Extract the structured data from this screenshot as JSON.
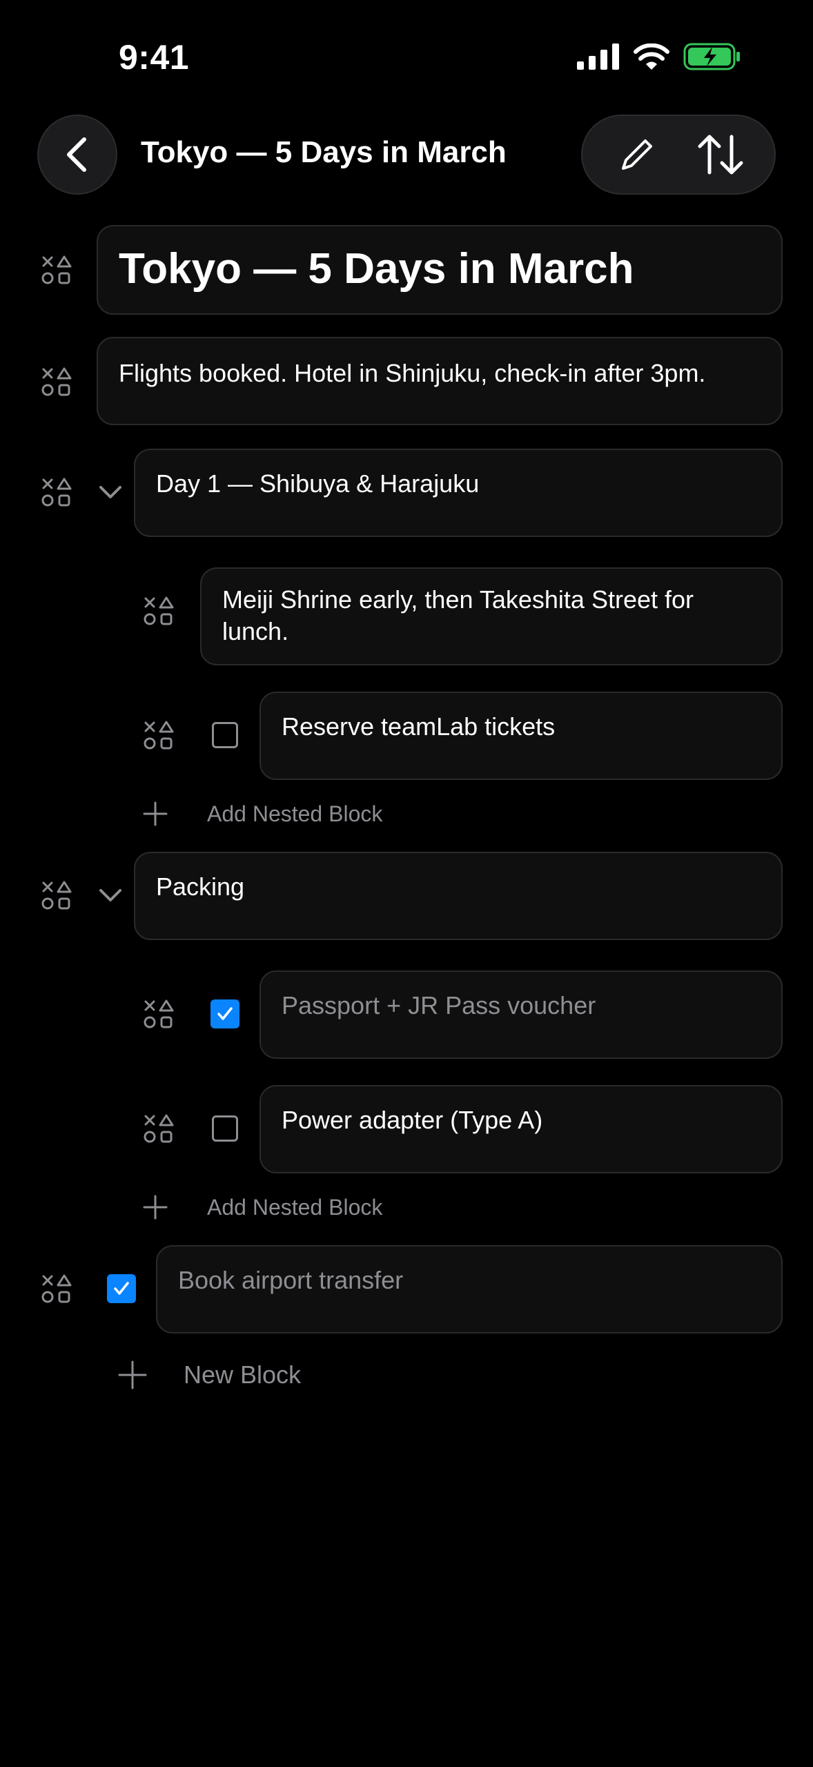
{
  "status": {
    "time": "9:41"
  },
  "nav": {
    "title": "Tokyo — 5 Days in March"
  },
  "blocks": {
    "title": "Tokyo — 5 Days in March",
    "note": "Flights booked. Hotel in Shinjuku, check-in after 3pm.",
    "day1": {
      "heading": "Day 1 — Shibuya & Harajuku",
      "note": "Meiji Shrine early, then Takeshita Street for lunch.",
      "todo": {
        "text": "Reserve teamLab tickets",
        "checked": false
      },
      "add_label": "Add Nested Block"
    },
    "packing": {
      "heading": "Packing",
      "todo1": {
        "text": "Passport + JR Pass voucher",
        "checked": true
      },
      "todo2": {
        "text": "Power adapter (Type A)",
        "checked": false
      },
      "add_label": "Add Nested Block"
    },
    "transfer": {
      "text": "Book airport transfer",
      "checked": true
    },
    "new_block_label": "New Block"
  },
  "colors": {
    "accent": "#0a84ff",
    "battery": "#34c759",
    "muted": "#8e8e93",
    "card": "#0f0f0f"
  },
  "icons": {
    "handle": "shapes-drag-icon",
    "back": "chevron-left-icon",
    "edit": "pencil-icon",
    "sort": "sort-arrows-icon",
    "collapse": "chevron-down-icon",
    "add": "plus-icon"
  }
}
